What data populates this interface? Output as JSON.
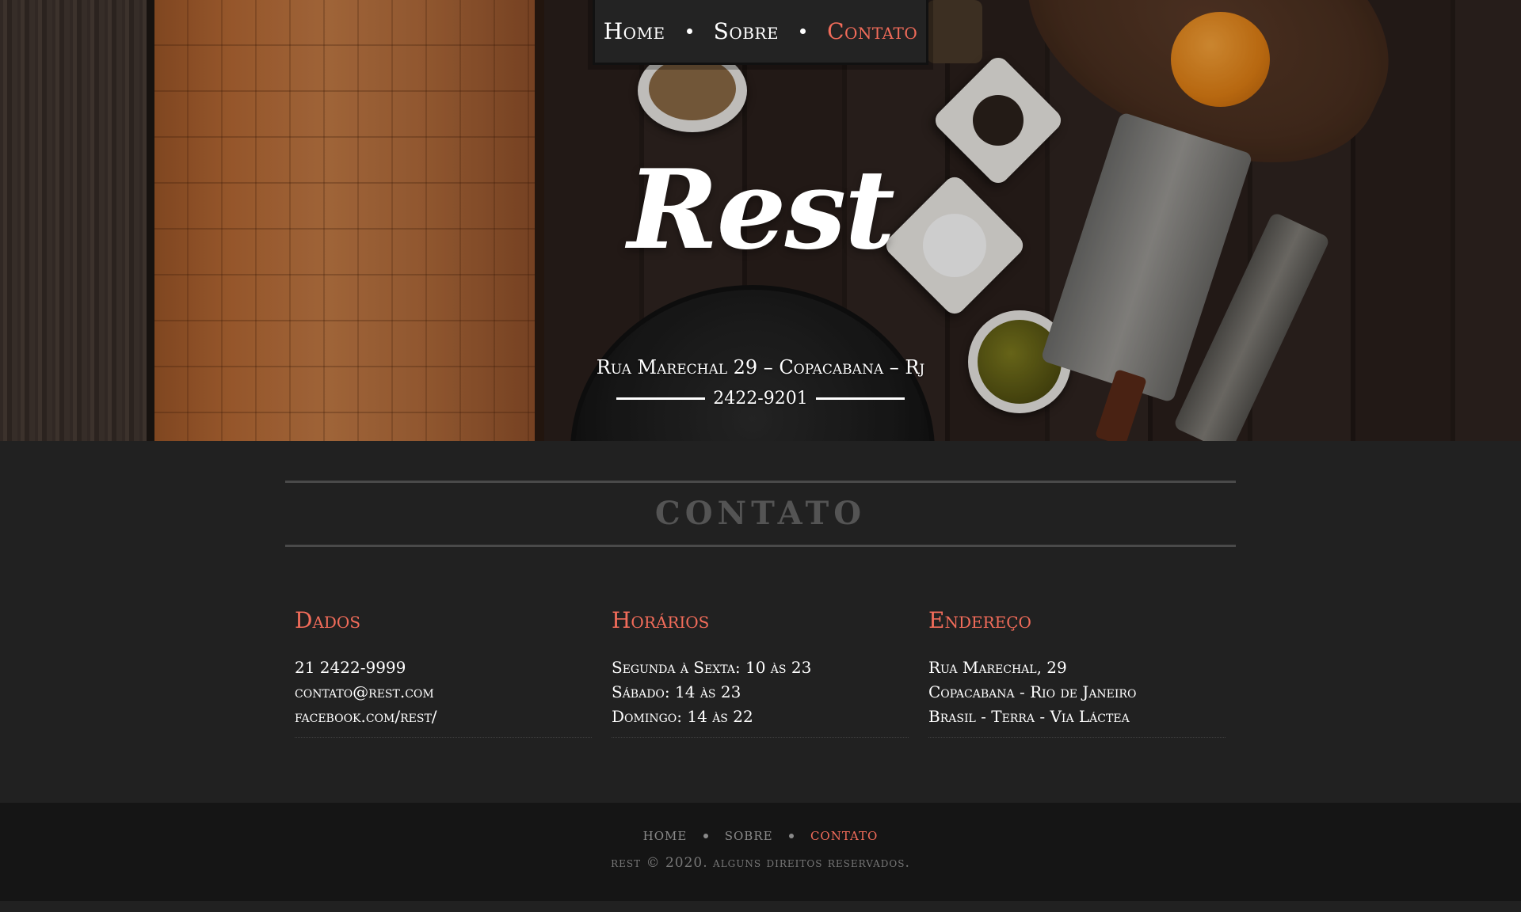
{
  "nav": {
    "items": [
      {
        "label": "Home",
        "active": false
      },
      {
        "label": "Sobre",
        "active": false
      },
      {
        "label": "Contato",
        "active": true
      }
    ]
  },
  "hero": {
    "logo_text": "Rest",
    "address": "Rua Marechal 29 – Copacabana – Rj",
    "phone": "2422-9201"
  },
  "section": {
    "title": "CONTATO"
  },
  "columns": [
    {
      "heading": "Dados",
      "lines": [
        "21 2422-9999",
        "contato@rest.com",
        "facebook.com/rest/"
      ]
    },
    {
      "heading": "Horários",
      "lines": [
        "Segunda à Sexta: 10 às 23",
        "Sábado: 14 às 23",
        "Domingo: 14 às 22"
      ]
    },
    {
      "heading": "Endereço",
      "lines": [
        "Rua Marechal, 29",
        "Copacabana - Rio de Janeiro",
        "Brasil - Terra - Via Láctea"
      ]
    }
  ],
  "footer": {
    "nav": [
      {
        "label": "home",
        "active": false
      },
      {
        "label": "sobre",
        "active": false
      },
      {
        "label": "contato",
        "active": true
      }
    ],
    "copyright": "rest © 2020. alguns direitos reservados."
  },
  "colors": {
    "accent": "#f26c5a",
    "background": "#212121",
    "footer_bg": "#151515"
  }
}
